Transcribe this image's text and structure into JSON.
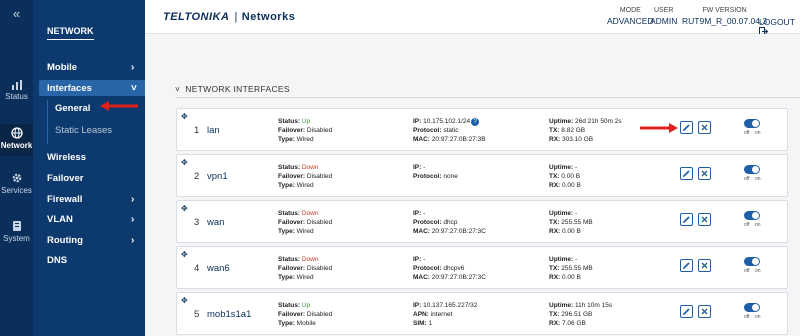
{
  "rail": {
    "collapse_glyph": "«",
    "items": [
      {
        "label": "Status",
        "icon": "bar-chart-icon"
      },
      {
        "label": "Network",
        "icon": "globe-icon",
        "active": true
      },
      {
        "label": "Services",
        "icon": "gear-icon"
      },
      {
        "label": "System",
        "icon": "server-icon"
      }
    ]
  },
  "nav": {
    "title": "NETWORK",
    "items": [
      {
        "label": "Mobile",
        "chevron": "›"
      },
      {
        "label": "Interfaces",
        "chevron": "˅"
      },
      {
        "label": "Wireless",
        "chevron": ""
      },
      {
        "label": "Failover",
        "chevron": ""
      },
      {
        "label": "Firewall",
        "chevron": "›"
      },
      {
        "label": "VLAN",
        "chevron": "›"
      },
      {
        "label": "Routing",
        "chevron": "›"
      },
      {
        "label": "DNS",
        "chevron": ""
      }
    ],
    "subitems": [
      {
        "label": "General"
      },
      {
        "label": "Static Leases"
      }
    ]
  },
  "header": {
    "brand": "TELTONIKA",
    "separator": "|",
    "product": "Networks",
    "mode_label": "MODE",
    "mode_value": "ADVANCED",
    "user_label": "USER",
    "user_value": "ADMIN",
    "fw_label": "FW VERSION",
    "fw_value": "RUT9M_R_00.07.04.3",
    "logout": "LOGOUT"
  },
  "section": {
    "title": "NETWORK INTERFACES",
    "chevron": "˅"
  },
  "interfaces": [
    {
      "index": "1",
      "name": "lan",
      "status": "Up",
      "failover": "Disabled",
      "type": "Wired",
      "ip": "10.175.102.1/24",
      "line2_label": "Protocol:",
      "line2_value": "static",
      "line3_label": "MAC:",
      "line3_value": "20:97:27:0B:27:3B",
      "uptime": "26d 21h 50m 2s",
      "tx": "8.82 GB",
      "rx": "303.10 GB"
    },
    {
      "index": "2",
      "name": "vpn1",
      "status": "Down",
      "failover": "Disabled",
      "type": "Wired",
      "ip": "-",
      "line2_label": "Protocol:",
      "line2_value": "none",
      "line3_label": "",
      "line3_value": "",
      "uptime": "-",
      "tx": "0.00 B",
      "rx": "0.00 B"
    },
    {
      "index": "3",
      "name": "wan",
      "status": "Down",
      "failover": "Disabled",
      "type": "Wired",
      "ip": "-",
      "line2_label": "Protocol:",
      "line2_value": "dhcp",
      "line3_label": "MAC:",
      "line3_value": "20:97:27:0B:27:3C",
      "uptime": "-",
      "tx": "255.55 MB",
      "rx": "0.00 B"
    },
    {
      "index": "4",
      "name": "wan6",
      "status": "Down",
      "failover": "Disabled",
      "type": "Wired",
      "ip": "-",
      "line2_label": "Protocol:",
      "line2_value": "dhcpv6",
      "line3_label": "MAC:",
      "line3_value": "20:97:27:0B:27:3C",
      "uptime": "-",
      "tx": "255.55 MB",
      "rx": "0.00 B"
    },
    {
      "index": "5",
      "name": "mob1s1a1",
      "status": "Up",
      "failover": "Disabled",
      "type": "Mobile",
      "ip": "10.137.165.227/32",
      "line2_label": "APN:",
      "line2_value": "internet",
      "line3_label": "SIM:",
      "line3_value": "1",
      "uptime": "11h 10m 15s",
      "tx": "296.51 GB",
      "rx": "7.06 GB"
    }
  ],
  "labels": {
    "status": "Status:",
    "failover": "Failover:",
    "type": "Type:",
    "ip": "IP:",
    "uptime": "Uptime:",
    "tx": "TX:",
    "rx": "RX:",
    "off": "off",
    "on": "on",
    "help": "?"
  },
  "colors": {
    "rail": "#0b2f5b",
    "nav": "#0d3a6e",
    "nav_active": "#2866a8",
    "status_up": "#3a9a3a",
    "status_down": "#d23a2a",
    "accent": "#1f5fa8",
    "annotation_arrow": "#e0201b"
  }
}
